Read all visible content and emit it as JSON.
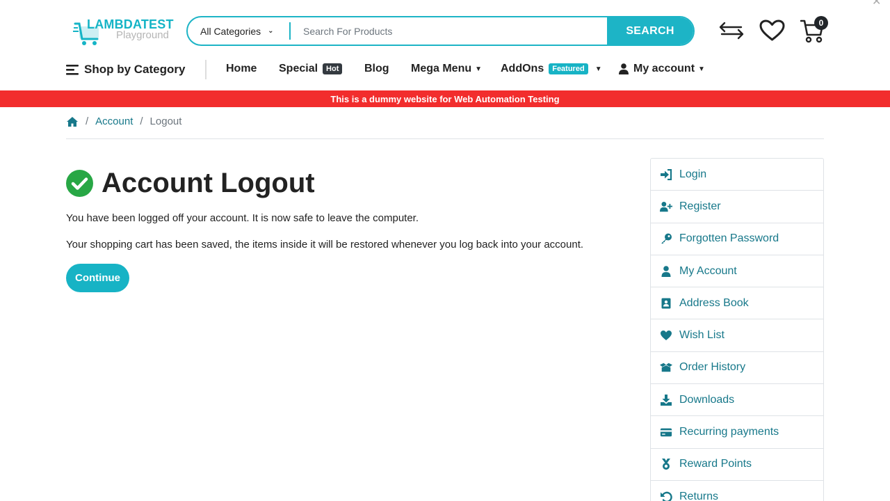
{
  "header": {
    "logo": {
      "brand": "LAMBDATEST",
      "subtitle": "Playground"
    },
    "search": {
      "category": "All Categories",
      "placeholder": "Search For Products",
      "button_label": "SEARCH"
    },
    "cart_count": "0"
  },
  "nav": {
    "shop_by_category": "Shop by Category",
    "items": [
      {
        "label": "Home"
      },
      {
        "label": "Special",
        "badge": "Hot"
      },
      {
        "label": "Blog"
      },
      {
        "label": "Mega Menu"
      },
      {
        "label": "AddOns",
        "badge": "Featured"
      },
      {
        "label": "My account"
      }
    ]
  },
  "banner": "This is a dummy website for Web Automation Testing",
  "breadcrumb": {
    "items": [
      "Account",
      "Logout"
    ]
  },
  "main": {
    "title": "Account Logout",
    "messages": [
      "You have been logged off your account. It is now safe to leave the computer.",
      "Your shopping cart has been saved, the items inside it will be restored whenever you log back into your account."
    ],
    "continue_label": "Continue"
  },
  "sidebar": {
    "items": [
      {
        "label": "Login",
        "icon": "sign-in-icon"
      },
      {
        "label": "Register",
        "icon": "user-plus-icon"
      },
      {
        "label": "Forgotten Password",
        "icon": "key-icon"
      },
      {
        "label": "My Account",
        "icon": "user-icon"
      },
      {
        "label": "Address Book",
        "icon": "address-book-icon"
      },
      {
        "label": "Wish List",
        "icon": "heart-icon"
      },
      {
        "label": "Order History",
        "icon": "box-open-icon"
      },
      {
        "label": "Downloads",
        "icon": "download-icon"
      },
      {
        "label": "Recurring payments",
        "icon": "credit-card-icon"
      },
      {
        "label": "Reward Points",
        "icon": "medal-icon"
      },
      {
        "label": "Returns",
        "icon": "undo-icon"
      }
    ]
  },
  "colors": {
    "accent": "#17b3c5",
    "link": "#17788a",
    "banner": "#f22d2d",
    "success": "#28a745"
  }
}
